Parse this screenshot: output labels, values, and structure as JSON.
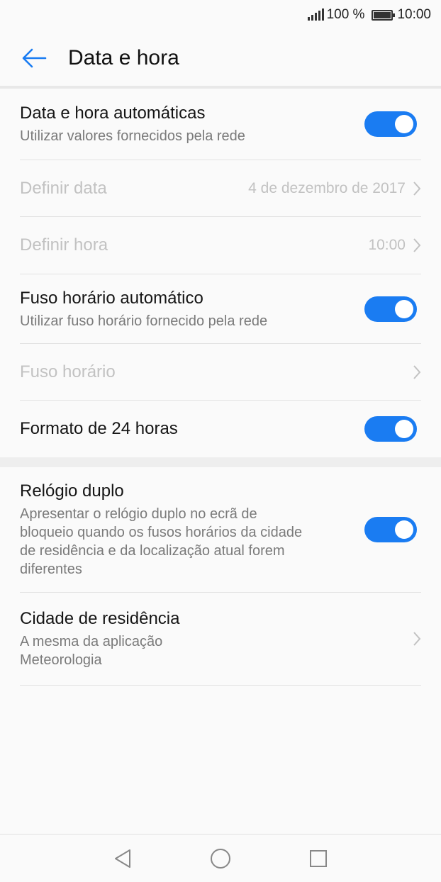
{
  "status_bar": {
    "battery": "100 %",
    "time": "10:00"
  },
  "header": {
    "title": "Data e hora",
    "back_icon": "arrow-left-icon"
  },
  "accent_color": "#1a7cf2",
  "items": {
    "auto_datetime": {
      "title": "Data e hora automáticas",
      "subtitle": "Utilizar valores fornecidos pela rede",
      "enabled": true
    },
    "set_date": {
      "title": "Definir data",
      "value": "4 de dezembro de 2017"
    },
    "set_time": {
      "title": "Definir hora",
      "value": "10:00"
    },
    "auto_timezone": {
      "title": "Fuso horário automático",
      "subtitle": "Utilizar fuso horário fornecido pela rede",
      "enabled": true
    },
    "timezone": {
      "title": "Fuso horário"
    },
    "format_24h": {
      "title": "Formato de 24 horas",
      "enabled": true
    },
    "dual_clock": {
      "title": "Relógio duplo",
      "subtitle_lines": [
        "Apresentar o relógio duplo no ecrã de",
        "bloqueio quando os fusos horários da cidade",
        "de residência e da localização atual forem",
        "diferentes"
      ],
      "enabled": true
    },
    "home_city": {
      "title": "Cidade de residência",
      "subtitle_lines": [
        "A mesma da aplicação",
        "Meteorologia"
      ]
    }
  },
  "nav_bar": {
    "back": "triangle-back-icon",
    "home": "circle-home-icon",
    "recents": "square-recents-icon"
  }
}
